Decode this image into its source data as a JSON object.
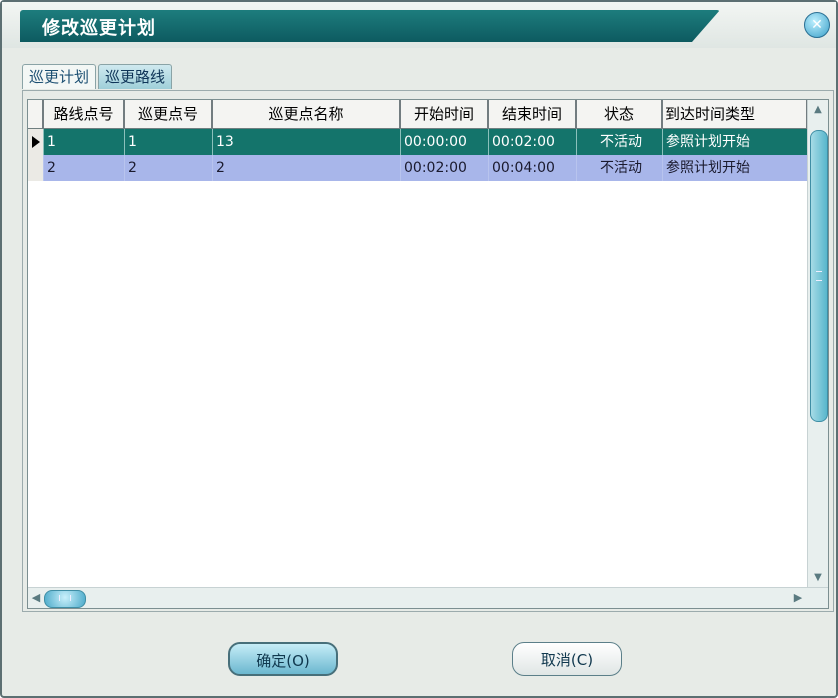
{
  "window": {
    "title": "修改巡更计划",
    "close_icon": "close-icon"
  },
  "tabs": [
    {
      "label": "巡更计划",
      "active": false
    },
    {
      "label": "巡更路线",
      "active": true
    }
  ],
  "grid": {
    "headers": [
      "路线点号",
      "巡更点号",
      "巡更点名称",
      "开始时间",
      "结束时间",
      "状态",
      "到达时间类型"
    ],
    "rows": [
      {
        "cells": [
          "1",
          "1",
          "13",
          "00:00:00",
          "00:02:00",
          "不活动",
          "参照计划开始"
        ],
        "selected": true
      },
      {
        "cells": [
          "2",
          "2",
          "2",
          "00:02:00",
          "00:04:00",
          "不活动",
          "参照计划开始"
        ],
        "selected": false
      }
    ]
  },
  "buttons": {
    "ok": "确定(O)",
    "cancel": "取消(C)"
  },
  "colors": {
    "title_bar": "#0d5a60",
    "selected_row": "#14746b",
    "alt_row": "#a8b6ea"
  }
}
